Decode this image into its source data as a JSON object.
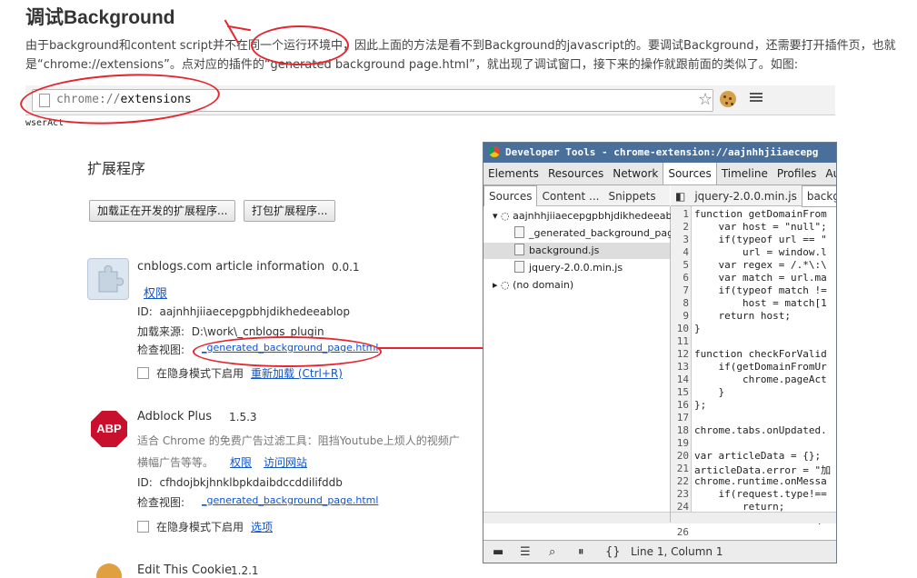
{
  "article": {
    "title": "调试Background",
    "paragraph_line1": "由于background和content script并不在同一个运行环境中，因此上面的方法是看不到Background的javascript的。要调试Background，还需要打开插件页，也就",
    "paragraph_line2": "是“chrome://extensions”。点对应的插件的“generated background page.html”，就出现了调试窗口，接下来的操作就跟前面的类似了。如图:"
  },
  "browser": {
    "url_scheme": "chrome://",
    "url_path": "extensions",
    "bookmark_text": "wserAct",
    "star_icon": "star-icon",
    "menu_icon": "hamburger-icon"
  },
  "extensions_page": {
    "heading": "扩展程序",
    "load_unpacked_button": "加载正在开发的扩展程序...",
    "pack_button": "打包扩展程序...",
    "items": [
      {
        "name": "cnblogs.com article information",
        "version": "0.0.1",
        "permissions_link": "权限",
        "id_label": "ID:",
        "id_value": "aajnhhjiiaecepgpbhjdikhedeeablop",
        "load_from_label": "加载来源:",
        "load_from_value": "D:\\work\\_cnblogs_plugin",
        "inspect_label": "检查视图:",
        "inspect_link": "_generated_background_page.html",
        "incognito_label": "在隐身模式下启用",
        "reload_link": "重新加载 (Ctrl+R)"
      },
      {
        "name": "Adblock Plus",
        "version": "1.5.3",
        "description_line1": "适合 Chrome 的免费广告过滤工具：阻挡Youtube上烦人的视频广",
        "description_line2": "横幅广告等等。",
        "permissions_link": "权限",
        "visit_link": "访问网站",
        "id_label": "ID:",
        "id_value": "cfhdojbkjhnklbpkdaibdccddilifddb",
        "inspect_label": "检查视图:",
        "inspect_link": "_generated_background_page.html",
        "incognito_label": "在隐身模式下启用",
        "options_link": "选项"
      },
      {
        "name": "Edit This Cookie",
        "version": "1.2.1"
      }
    ]
  },
  "devtools": {
    "title": "Developer Tools - chrome-extension://aajnhhjiiaecepg",
    "tabs": [
      "Elements",
      "Resources",
      "Network",
      "Sources",
      "Timeline",
      "Profiles",
      "Audit"
    ],
    "active_tab": "Sources",
    "sub_tabs": [
      "Sources",
      "Content ...",
      "Snippets"
    ],
    "file_tabs": [
      "jquery-2.0.0.min.js",
      "backgr"
    ],
    "tree": [
      {
        "label": "aajnhhjiiaecepgpbhjdikhedeeab",
        "type": "folder-open"
      },
      {
        "label": "_generated_background_page",
        "type": "file"
      },
      {
        "label": "background.js",
        "type": "file-selected"
      },
      {
        "label": "jquery-2.0.0.min.js",
        "type": "file"
      },
      {
        "label": "(no domain)",
        "type": "folder-closed"
      }
    ],
    "code_lines": [
      "function getDomainFrom",
      "    var host = \"null\";",
      "    if(typeof url == \"",
      "        url = window.l",
      "    var regex = /.*\\:\\",
      "    var match = url.ma",
      "    if(typeof match !=",
      "        host = match[1",
      "    return host;",
      "}",
      "",
      "function checkForValid",
      "    if(getDomainFromUr",
      "        chrome.pageAct",
      "    }",
      "};",
      "",
      "chrome.tabs.onUpdated.",
      "",
      "var articleData = {};",
      "articleData.error = \"加",
      "chrome.runtime.onMessa",
      "    if(request.type!==",
      "        return;",
      "    articleData = requ",
      ""
    ],
    "status": "Line 1, Column 1"
  }
}
